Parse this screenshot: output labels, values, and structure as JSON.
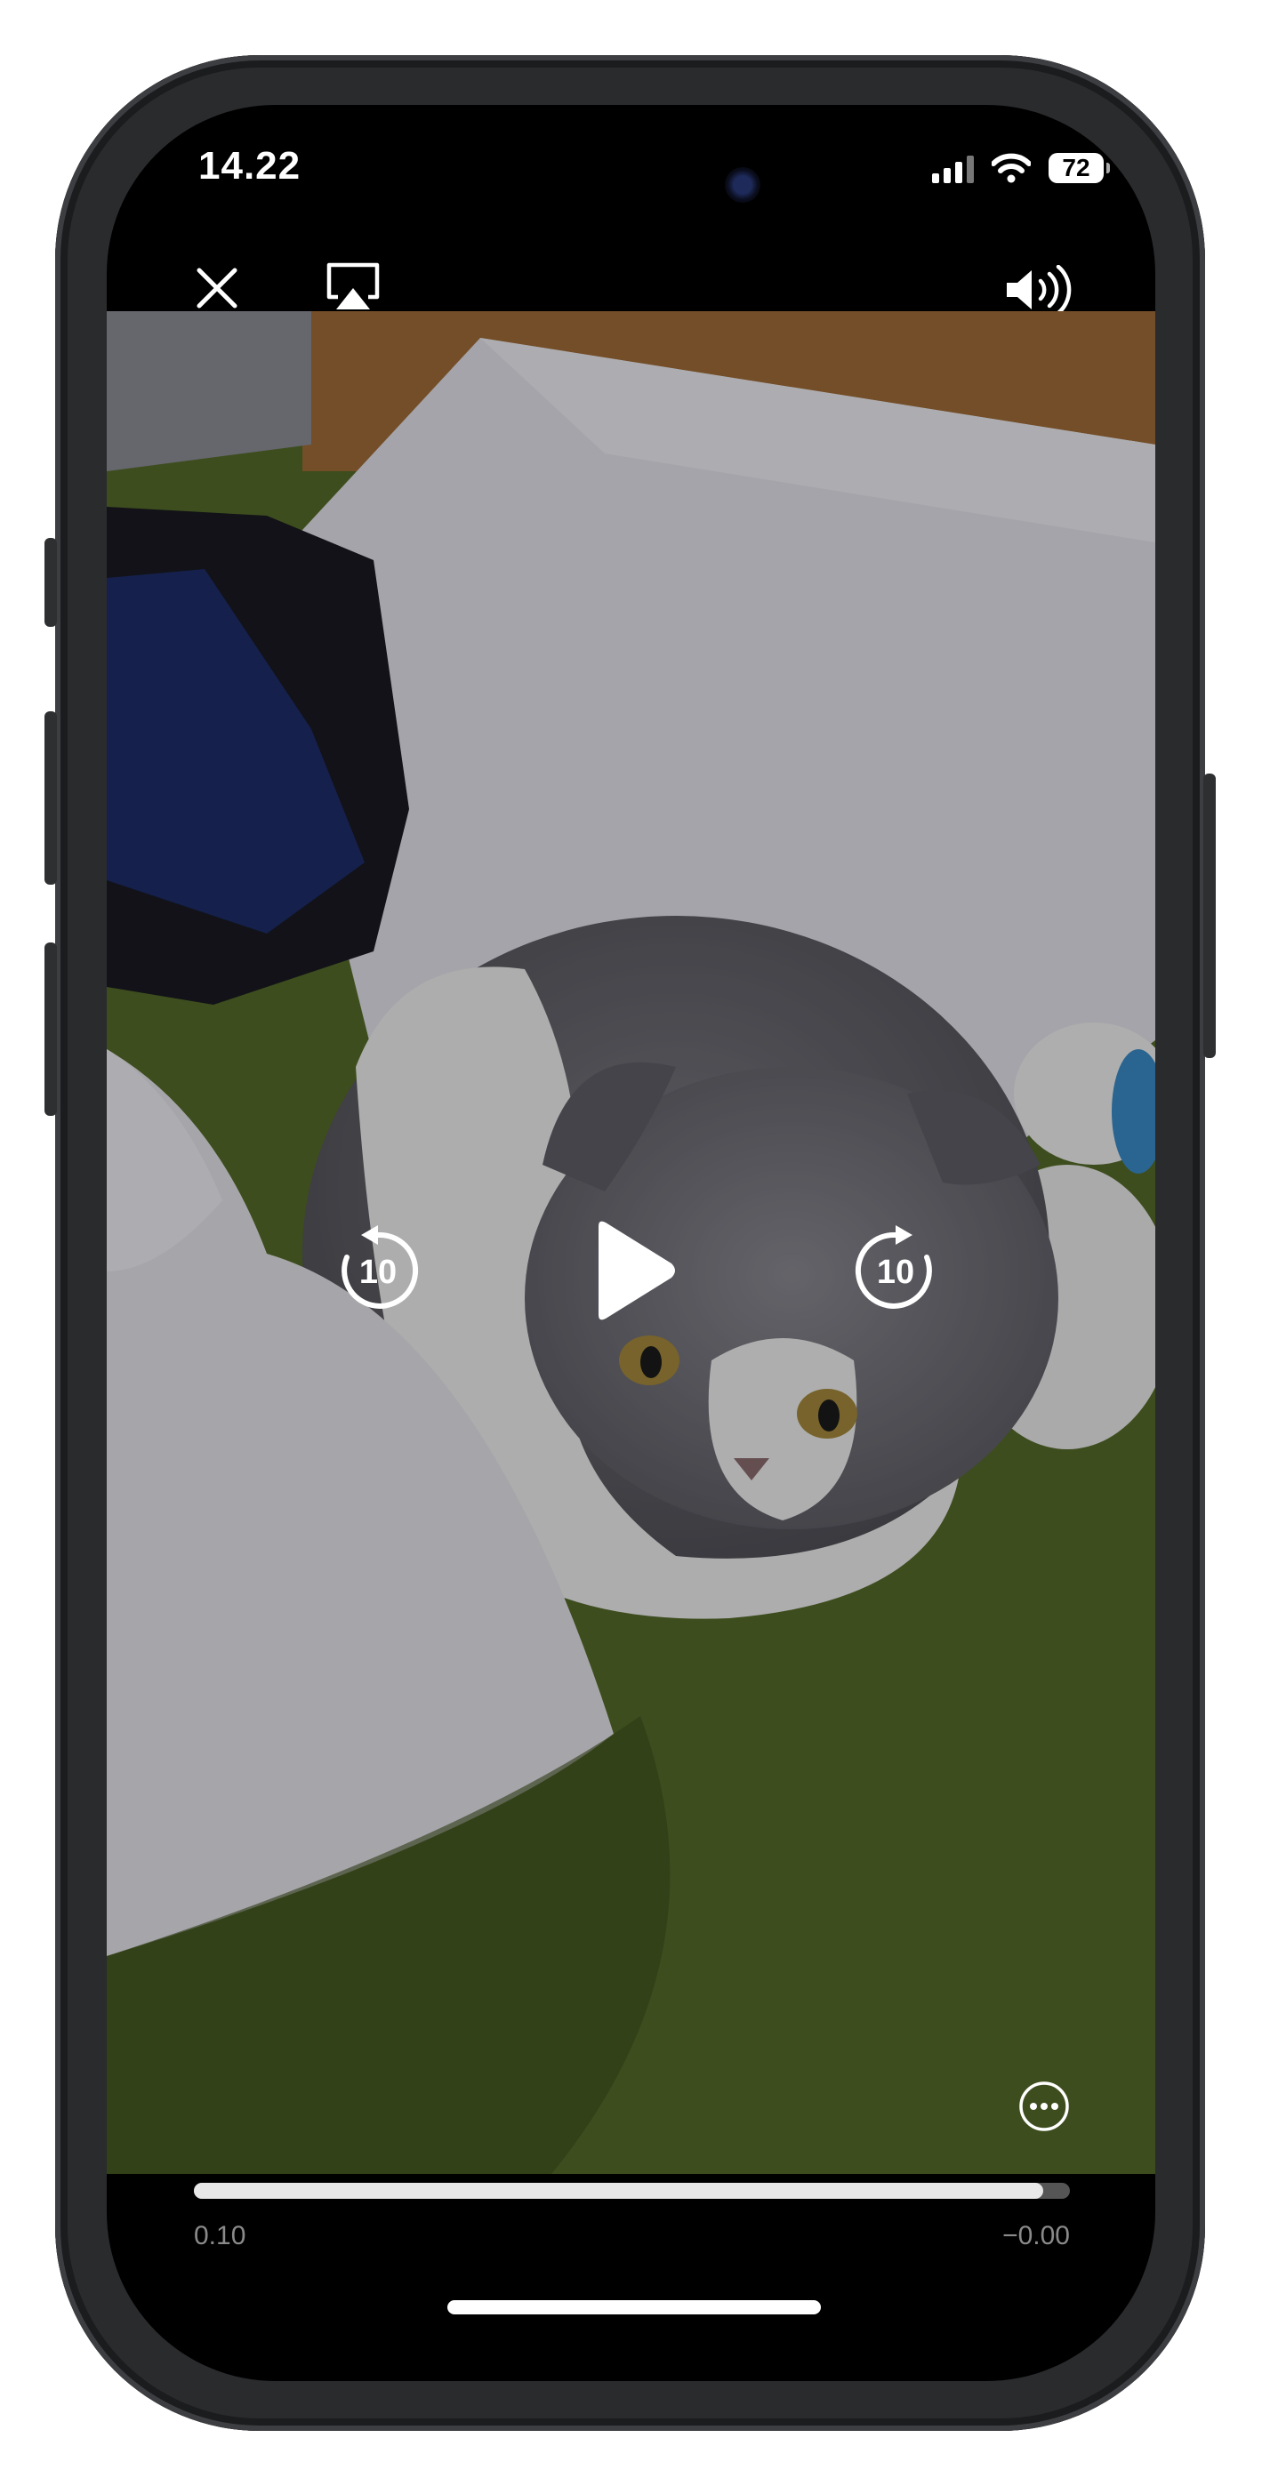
{
  "status_bar": {
    "time": "14.22",
    "battery": "72",
    "signal_icon": "cellular-signal-icon",
    "wifi_icon": "wifi-icon"
  },
  "player": {
    "close_icon": "close-icon",
    "airplay_icon": "airplay-icon",
    "volume_icon": "speaker-volume-icon",
    "skip_back_label": "10",
    "skip_forward_label": "10",
    "play_icon": "play-icon",
    "more_icon": "more-options-icon",
    "elapsed_time": "0.10",
    "remaining_time": "−0.00",
    "progress": 0.97
  },
  "colors": {
    "screen_background": "#000000",
    "progress_fill": "#e8e8e8",
    "progress_track": "#555555",
    "time_text": "#8a8a8a"
  }
}
